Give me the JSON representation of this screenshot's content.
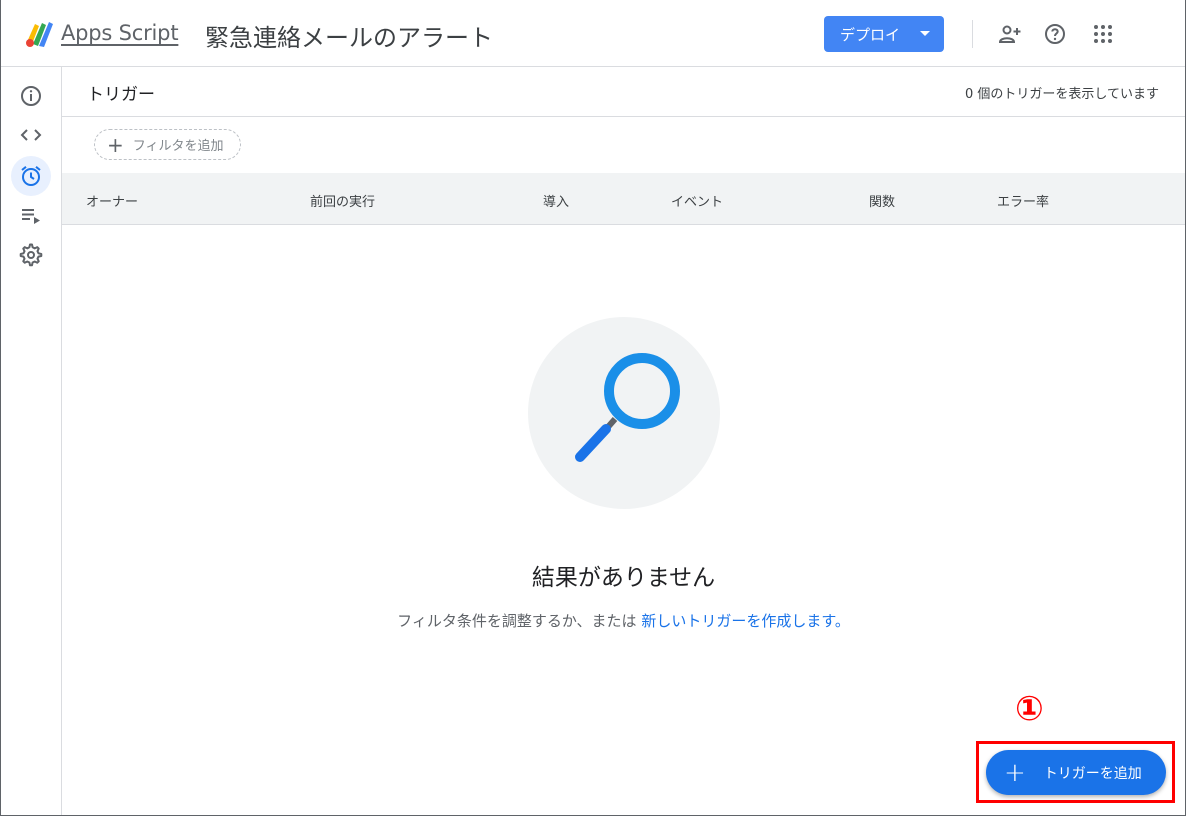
{
  "header": {
    "app_name": "Apps Script",
    "project_title": "緊急連絡メールのアラート",
    "deploy_label": "デプロイ",
    "icons": [
      "add-person-icon",
      "help-icon",
      "apps-grid-icon"
    ]
  },
  "sidebar": {
    "items": [
      {
        "name": "overview",
        "icon": "info-icon"
      },
      {
        "name": "editor",
        "icon": "code-icon"
      },
      {
        "name": "triggers",
        "icon": "alarm-clock-icon",
        "active": true
      },
      {
        "name": "executions",
        "icon": "executions-list-icon"
      },
      {
        "name": "settings",
        "icon": "gear-icon"
      }
    ]
  },
  "main": {
    "page_title": "トリガー",
    "trigger_count": "0 個のトリガーを表示しています",
    "filter_label": "フィルタを追加",
    "columns": [
      "オーナー",
      "前回の実行",
      "導入",
      "イベント",
      "関数",
      "エラー率"
    ],
    "empty": {
      "title": "結果がありません",
      "desc_prefix": "フィルタ条件を調整するか、または",
      "desc_link": "新しいトリガーを作成します。"
    },
    "fab_label": "トリガーを追加"
  },
  "annotation": {
    "number": "①"
  },
  "colors": {
    "accent": "#1a73e8",
    "deploy": "#4285f4",
    "annotation": "#ff0000"
  }
}
